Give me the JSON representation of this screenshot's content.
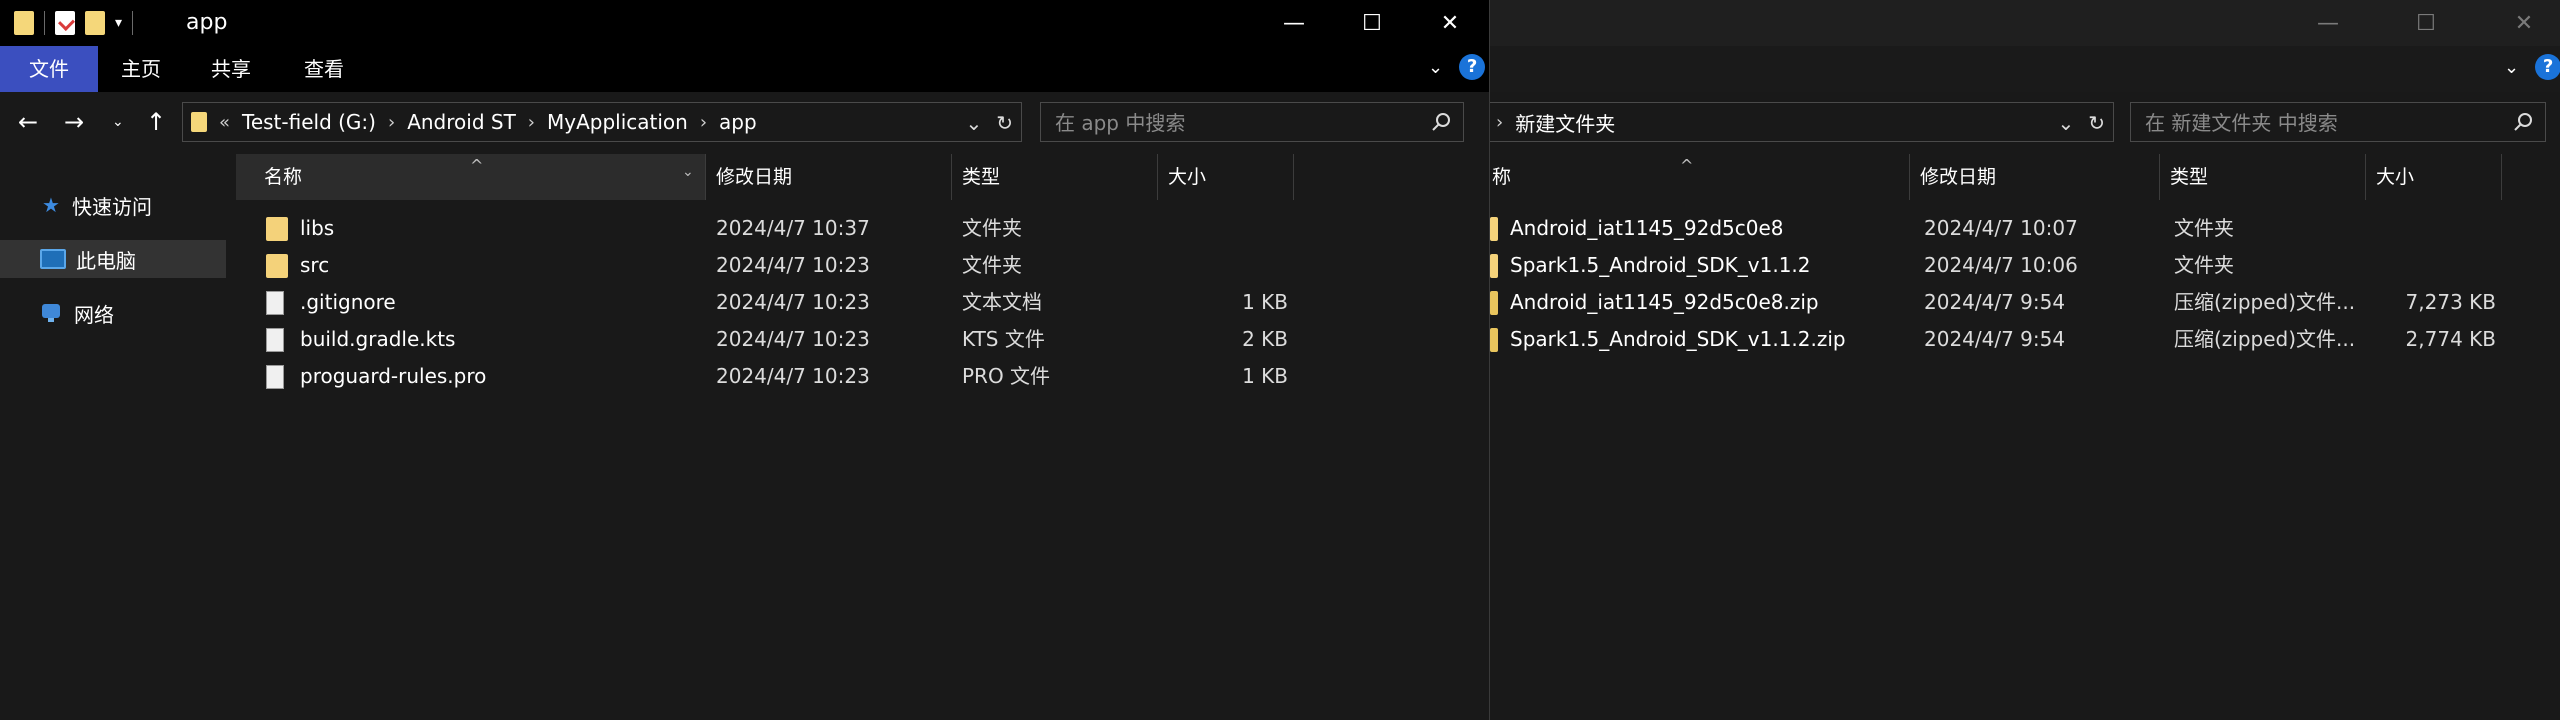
{
  "front_window": {
    "title": "app",
    "ribbon_tabs": [
      "文件",
      "主页",
      "共享",
      "查看"
    ],
    "breadcrumb": [
      "Test-field (G:)",
      "Android ST",
      "MyApplication",
      "app"
    ],
    "breadcrumb_overflow": "«",
    "search_placeholder": "在 app 中搜索",
    "nav_items": [
      "快速访问",
      "此电脑",
      "网络"
    ],
    "columns": [
      "名称",
      "修改日期",
      "类型",
      "大小"
    ],
    "files": [
      {
        "name": "libs",
        "date": "2024/4/7 10:37",
        "type": "文件夹",
        "size": "",
        "icon": "folder-icon"
      },
      {
        "name": "src",
        "date": "2024/4/7 10:23",
        "type": "文件夹",
        "size": "",
        "icon": "folder-icon"
      },
      {
        "name": ".gitignore",
        "date": "2024/4/7 10:23",
        "type": "文本文档",
        "size": "1 KB",
        "icon": "file-icon"
      },
      {
        "name": "build.gradle.kts",
        "date": "2024/4/7 10:23",
        "type": "KTS 文件",
        "size": "2 KB",
        "icon": "file-icon"
      },
      {
        "name": "proguard-rules.pro",
        "date": "2024/4/7 10:23",
        "type": "PRO 文件",
        "size": "1 KB",
        "icon": "file-icon"
      }
    ]
  },
  "back_window": {
    "breadcrumb": [
      "新建文件夹"
    ],
    "search_placeholder": "在 新建文件夹 中搜索",
    "columns": [
      "称",
      "修改日期",
      "类型",
      "大小"
    ],
    "files": [
      {
        "name": "Android_iat1145_92d5c0e8",
        "date": "2024/4/7 10:07",
        "type": "文件夹",
        "size": "",
        "icon": "folder-icon"
      },
      {
        "name": "Spark1.5_Android_SDK_v1.1.2",
        "date": "2024/4/7 10:06",
        "type": "文件夹",
        "size": "",
        "icon": "folder-icon"
      },
      {
        "name": "Android_iat1145_92d5c0e8.zip",
        "date": "2024/4/7 9:54",
        "type": "压缩(zipped)文件...",
        "size": "7,273 KB",
        "icon": "zip-icon"
      },
      {
        "name": "Spark1.5_Android_SDK_v1.1.2.zip",
        "date": "2024/4/7 9:54",
        "type": "压缩(zipped)文件...",
        "size": "2,774 KB",
        "icon": "zip-icon"
      }
    ]
  },
  "colors": {
    "accent": "#3b4fbf",
    "folder": "#f4d27a",
    "help": "#1a73d9"
  }
}
